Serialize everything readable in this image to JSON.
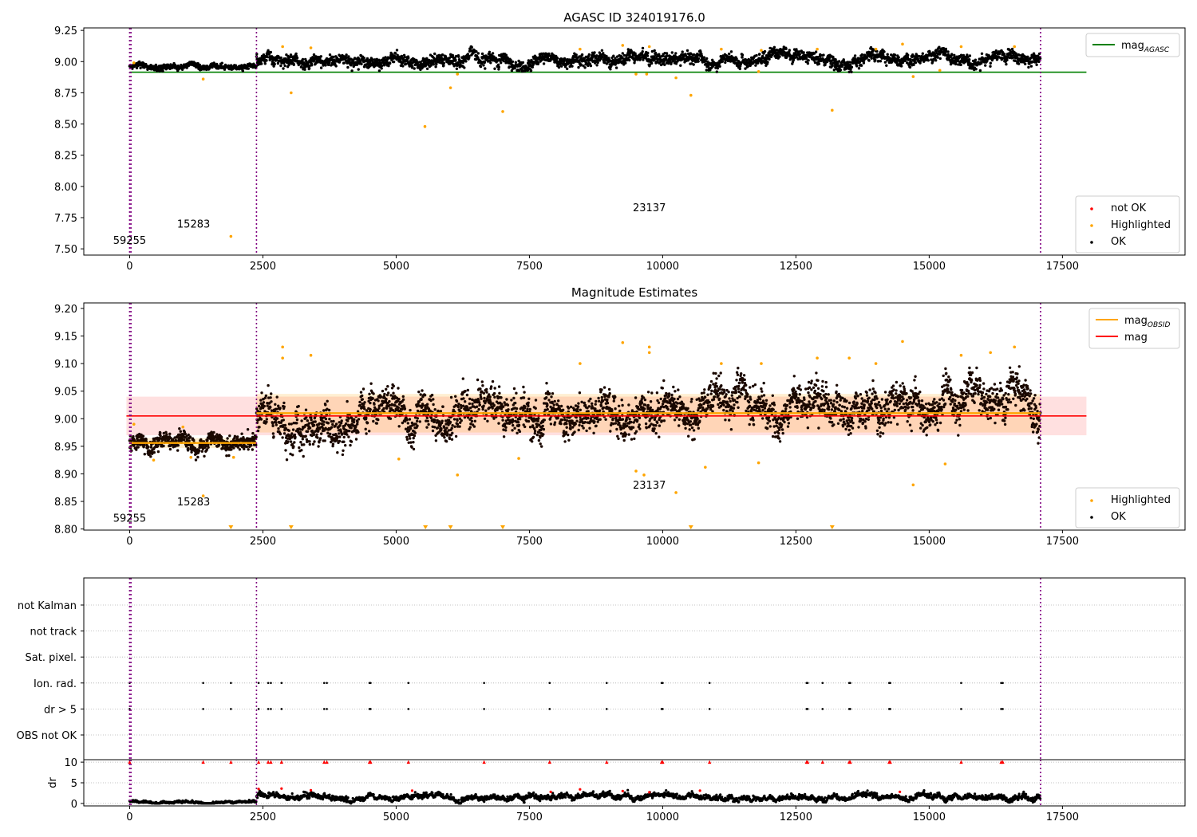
{
  "chart_data": [
    {
      "id": "p1",
      "type": "scatter",
      "title": "AGASC ID 324019176.0",
      "xlim": [
        -860,
        19800
      ],
      "ylim": [
        7.45,
        9.27
      ],
      "xticks": [
        0,
        2500,
        5000,
        7500,
        10000,
        12500,
        15000,
        17500
      ],
      "xtick_labels": [
        "0",
        "2500",
        "5000",
        "7500",
        "10000",
        "12500",
        "15000",
        "17500"
      ],
      "yticks": [
        7.5,
        7.75,
        8.0,
        8.25,
        8.5,
        8.75,
        9.0,
        9.25
      ],
      "ytick_labels": [
        "7.50",
        "7.75",
        "8.00",
        "8.25",
        "8.50",
        "8.75",
        "9.00",
        "9.25"
      ],
      "vlines": [
        0,
        25,
        2380,
        17090
      ],
      "hlines": [
        {
          "name": "mag_AGASC",
          "y": 8.915,
          "x_range": [
            0,
            17950
          ],
          "color": "#008000"
        }
      ],
      "obsid_labels": [
        {
          "text": "59255",
          "x": 0,
          "y": 7.54
        },
        {
          "text": "15283",
          "x": 1200,
          "y": 7.67
        },
        {
          "text": "23137",
          "x": 9750,
          "y": 7.8
        }
      ],
      "ok_segments": [
        {
          "x_range": [
            0,
            2380
          ],
          "y_mean": 8.96,
          "y_spread": 0.018
        },
        {
          "x_range": [
            2380,
            17090
          ],
          "y_mean_range": [
            9.0,
            9.045
          ],
          "y_spread": 0.04
        }
      ],
      "highlighted_points": [
        {
          "x": 80,
          "y": 8.99
        },
        {
          "x": 1380,
          "y": 8.86
        },
        {
          "x": 1900,
          "y": 7.6
        },
        {
          "x": 2870,
          "y": 9.12
        },
        {
          "x": 3030,
          "y": 8.75
        },
        {
          "x": 3400,
          "y": 9.11
        },
        {
          "x": 5540,
          "y": 8.48
        },
        {
          "x": 6020,
          "y": 8.79
        },
        {
          "x": 6150,
          "y": 8.9
        },
        {
          "x": 7000,
          "y": 8.6
        },
        {
          "x": 8450,
          "y": 9.1
        },
        {
          "x": 9250,
          "y": 9.13
        },
        {
          "x": 9500,
          "y": 8.9
        },
        {
          "x": 9700,
          "y": 8.9
        },
        {
          "x": 9750,
          "y": 9.12
        },
        {
          "x": 10250,
          "y": 8.87
        },
        {
          "x": 10530,
          "y": 8.73
        },
        {
          "x": 11100,
          "y": 9.1
        },
        {
          "x": 11800,
          "y": 8.92
        },
        {
          "x": 11850,
          "y": 9.09
        },
        {
          "x": 12900,
          "y": 9.1
        },
        {
          "x": 13180,
          "y": 8.61
        },
        {
          "x": 14000,
          "y": 9.1
        },
        {
          "x": 14500,
          "y": 9.14
        },
        {
          "x": 14700,
          "y": 8.88
        },
        {
          "x": 15200,
          "y": 8.93
        },
        {
          "x": 15600,
          "y": 9.12
        },
        {
          "x": 16600,
          "y": 9.12
        }
      ],
      "legend_top": {
        "placement": "upper right",
        "entries": [
          {
            "label": "mag",
            "sub": "AGASC",
            "color": "#008000"
          }
        ]
      },
      "legend_bottom": {
        "placement": "lower right",
        "entries": [
          {
            "label": "not OK",
            "color": "#ff0000"
          },
          {
            "label": "Highlighted",
            "color": "#ffa500"
          },
          {
            "label": "OK",
            "color": "#000000"
          }
        ]
      }
    },
    {
      "id": "p2",
      "type": "scatter",
      "title": "Magnitude Estimates",
      "xlim": [
        -860,
        19800
      ],
      "ylim": [
        8.798,
        9.21
      ],
      "xticks": [
        0,
        2500,
        5000,
        7500,
        10000,
        12500,
        15000,
        17500
      ],
      "xtick_labels": [
        "0",
        "2500",
        "5000",
        "7500",
        "10000",
        "12500",
        "15000",
        "17500"
      ],
      "yticks": [
        8.8,
        8.85,
        8.9,
        8.95,
        9.0,
        9.05,
        9.1,
        9.15,
        9.2
      ],
      "ytick_labels": [
        "8.80",
        "8.85",
        "8.90",
        "8.95",
        "9.00",
        "9.05",
        "9.10",
        "9.15",
        "9.20"
      ],
      "vlines": [
        0,
        25,
        2380,
        17090
      ],
      "mag": {
        "y": 9.005,
        "x_range": [
          -60,
          17950
        ],
        "band": [
          8.97,
          9.04
        ],
        "color": "#ff0000"
      },
      "mag_obsid": [
        {
          "x_range": [
            0,
            2380
          ],
          "y": 8.956,
          "band": [
            8.947,
            8.965
          ]
        },
        {
          "x_range": [
            2380,
            17090
          ],
          "y": 9.01,
          "band": [
            8.975,
            9.045
          ]
        }
      ],
      "obsid_labels": [
        {
          "text": "59255",
          "x": 0,
          "y": 8.813
        },
        {
          "text": "15283",
          "x": 1200,
          "y": 8.843
        },
        {
          "text": "23137",
          "x": 9750,
          "y": 8.873
        }
      ],
      "ok_segments": [
        {
          "x_range": [
            0,
            2380
          ],
          "y_mean": 8.955,
          "y_spread": 0.012
        },
        {
          "x_range": [
            2380,
            17090
          ],
          "y_mean_range": [
            9.0,
            9.03
          ],
          "y_spread": 0.028
        }
      ],
      "highlighted_points": [
        {
          "x": 80,
          "y": 8.99
        },
        {
          "x": 450,
          "y": 8.925
        },
        {
          "x": 1000,
          "y": 8.985
        },
        {
          "x": 1150,
          "y": 8.93
        },
        {
          "x": 1380,
          "y": 8.86
        },
        {
          "x": 1950,
          "y": 8.93
        },
        {
          "x": 2870,
          "y": 9.13
        },
        {
          "x": 2870,
          "y": 9.11
        },
        {
          "x": 3400,
          "y": 9.115
        },
        {
          "x": 5050,
          "y": 8.927
        },
        {
          "x": 6150,
          "y": 8.898
        },
        {
          "x": 7300,
          "y": 8.928
        },
        {
          "x": 8450,
          "y": 9.1
        },
        {
          "x": 9250,
          "y": 9.138
        },
        {
          "x": 9500,
          "y": 8.905
        },
        {
          "x": 9650,
          "y": 8.898
        },
        {
          "x": 9750,
          "y": 9.13
        },
        {
          "x": 9750,
          "y": 9.12
        },
        {
          "x": 10250,
          "y": 8.866
        },
        {
          "x": 10800,
          "y": 8.912
        },
        {
          "x": 11100,
          "y": 9.1
        },
        {
          "x": 11800,
          "y": 8.92
        },
        {
          "x": 11850,
          "y": 9.1
        },
        {
          "x": 12900,
          "y": 9.11
        },
        {
          "x": 13500,
          "y": 9.11
        },
        {
          "x": 14000,
          "y": 9.1
        },
        {
          "x": 14500,
          "y": 9.14
        },
        {
          "x": 14700,
          "y": 8.88
        },
        {
          "x": 15300,
          "y": 8.918
        },
        {
          "x": 15600,
          "y": 9.115
        },
        {
          "x": 16150,
          "y": 9.12
        },
        {
          "x": 16600,
          "y": 9.13
        }
      ],
      "offscale_markers": [
        1900,
        3030,
        5550,
        6020,
        7000,
        10530,
        13180
      ],
      "legend_top": {
        "placement": "upper right",
        "entries": [
          {
            "label": "mag",
            "sub": "OBSID",
            "color": "#ffa500"
          },
          {
            "label": "mag",
            "sub": "",
            "color": "#ff0000"
          }
        ]
      },
      "legend_bottom": {
        "placement": "lower right",
        "entries": [
          {
            "label": "Highlighted",
            "color": "#ffa500"
          },
          {
            "label": "OK",
            "color": "#000000"
          }
        ]
      }
    },
    {
      "id": "p3",
      "type": "scatter",
      "xlim": [
        -860,
        19800
      ],
      "category_labels": [
        "not Kalman",
        "not track",
        "Sat. pixel.",
        "Ion. rad.",
        "dr > 5",
        "OBS not OK"
      ],
      "flag_rows": [
        "Ion. rad.",
        "dr > 5"
      ],
      "flag_x": [
        0,
        1380,
        1900,
        2420,
        2600,
        2650,
        2850,
        3650,
        3700,
        4500,
        4520,
        5230,
        6650,
        7880,
        8950,
        9980,
        10000,
        10880,
        12700,
        12720,
        13000,
        13500,
        13520,
        14250,
        14270,
        15600,
        16350,
        16380
      ],
      "vlines": [
        0,
        25,
        2380,
        17090
      ]
    },
    {
      "id": "p4",
      "type": "scatter",
      "xlim": [
        -860,
        19800
      ],
      "ylim": [
        -0.6,
        10.6
      ],
      "ylabel": "dr",
      "yticks": [
        0,
        5,
        10
      ],
      "ytick_labels": [
        "0",
        "5",
        "10"
      ],
      "xticks": [
        0,
        2500,
        5000,
        7500,
        10000,
        12500,
        15000,
        17500
      ],
      "xtick_labels": [
        "0",
        "2500",
        "5000",
        "7500",
        "10000",
        "12500",
        "15000",
        "17500"
      ],
      "vlines": [
        0,
        25,
        2380,
        17090
      ],
      "dr_segments": [
        {
          "x_range": [
            0,
            2380
          ],
          "y_mean": 0.25,
          "y_spread": 0.4
        },
        {
          "x_range": [
            2380,
            17090
          ],
          "y_mean": 1.1,
          "y_spread": 0.9
        }
      ],
      "capped_x": [
        0,
        1380,
        1900,
        2420,
        2600,
        2650,
        2850,
        3650,
        3700,
        4500,
        4520,
        5230,
        6650,
        7880,
        8950,
        9980,
        10000,
        10880,
        12700,
        12720,
        13000,
        13500,
        13520,
        14250,
        14270,
        15600,
        16350,
        16380
      ],
      "dr_spikes": [
        {
          "x": 2420,
          "y": 3.5
        },
        {
          "x": 2850,
          "y": 3.6
        },
        {
          "x": 3400,
          "y": 3.2
        },
        {
          "x": 5300,
          "y": 3.1
        },
        {
          "x": 7900,
          "y": 2.8
        },
        {
          "x": 8450,
          "y": 3.4
        },
        {
          "x": 9250,
          "y": 3.0
        },
        {
          "x": 9750,
          "y": 2.7
        },
        {
          "x": 10700,
          "y": 3.1
        },
        {
          "x": 14450,
          "y": 2.8
        }
      ]
    }
  ]
}
